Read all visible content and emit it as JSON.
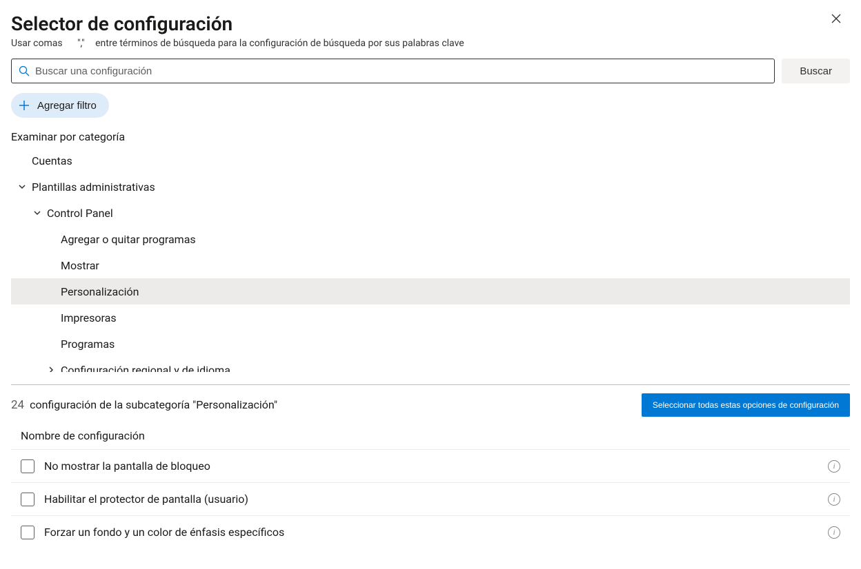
{
  "header": {
    "title": "Selector de configuración",
    "hint_prefix": "Usar comas",
    "hint_comma": "\",\"",
    "hint_suffix": "entre términos de búsqueda para la configuración de búsqueda por sus palabras clave"
  },
  "search": {
    "placeholder": "Buscar una configuración",
    "button_label": "Buscar"
  },
  "filter": {
    "add_label": "Agregar filtro"
  },
  "browse": {
    "heading": "Examinar por categoría",
    "items": [
      {
        "label": "Cuentas",
        "indent": "indent-0",
        "chev": "none",
        "selected": false
      },
      {
        "label": "Plantillas administrativas",
        "indent": "indent-1",
        "chev": "down",
        "selected": false
      },
      {
        "label": "Control Panel",
        "indent": "indent-2",
        "chev": "down",
        "selected": false
      },
      {
        "label": "Agregar o quitar programas",
        "indent": "indent-3",
        "chev": "none",
        "selected": false
      },
      {
        "label": "Mostrar",
        "indent": "indent-3",
        "chev": "none",
        "selected": false
      },
      {
        "label": "Personalización",
        "indent": "indent-3",
        "chev": "none",
        "selected": true
      },
      {
        "label": "Impresoras",
        "indent": "indent-3",
        "chev": "none",
        "selected": false
      },
      {
        "label": "Programas",
        "indent": "indent-3",
        "chev": "none",
        "selected": false
      },
      {
        "label": "Configuración regional y de idioma",
        "indent": "indent-2b",
        "chev": "right",
        "selected": false
      }
    ]
  },
  "results": {
    "count": "24",
    "label": "configuración de la subcategoría \"Personalización\"",
    "select_all": "Seleccionar todas estas opciones de configuración",
    "column_header": "Nombre de configuración",
    "settings": [
      {
        "name": "No mostrar la pantalla de bloqueo"
      },
      {
        "name": "Habilitar el protector de pantalla (usuario)"
      },
      {
        "name": "Forzar un fondo y un color de énfasis específicos"
      }
    ]
  }
}
